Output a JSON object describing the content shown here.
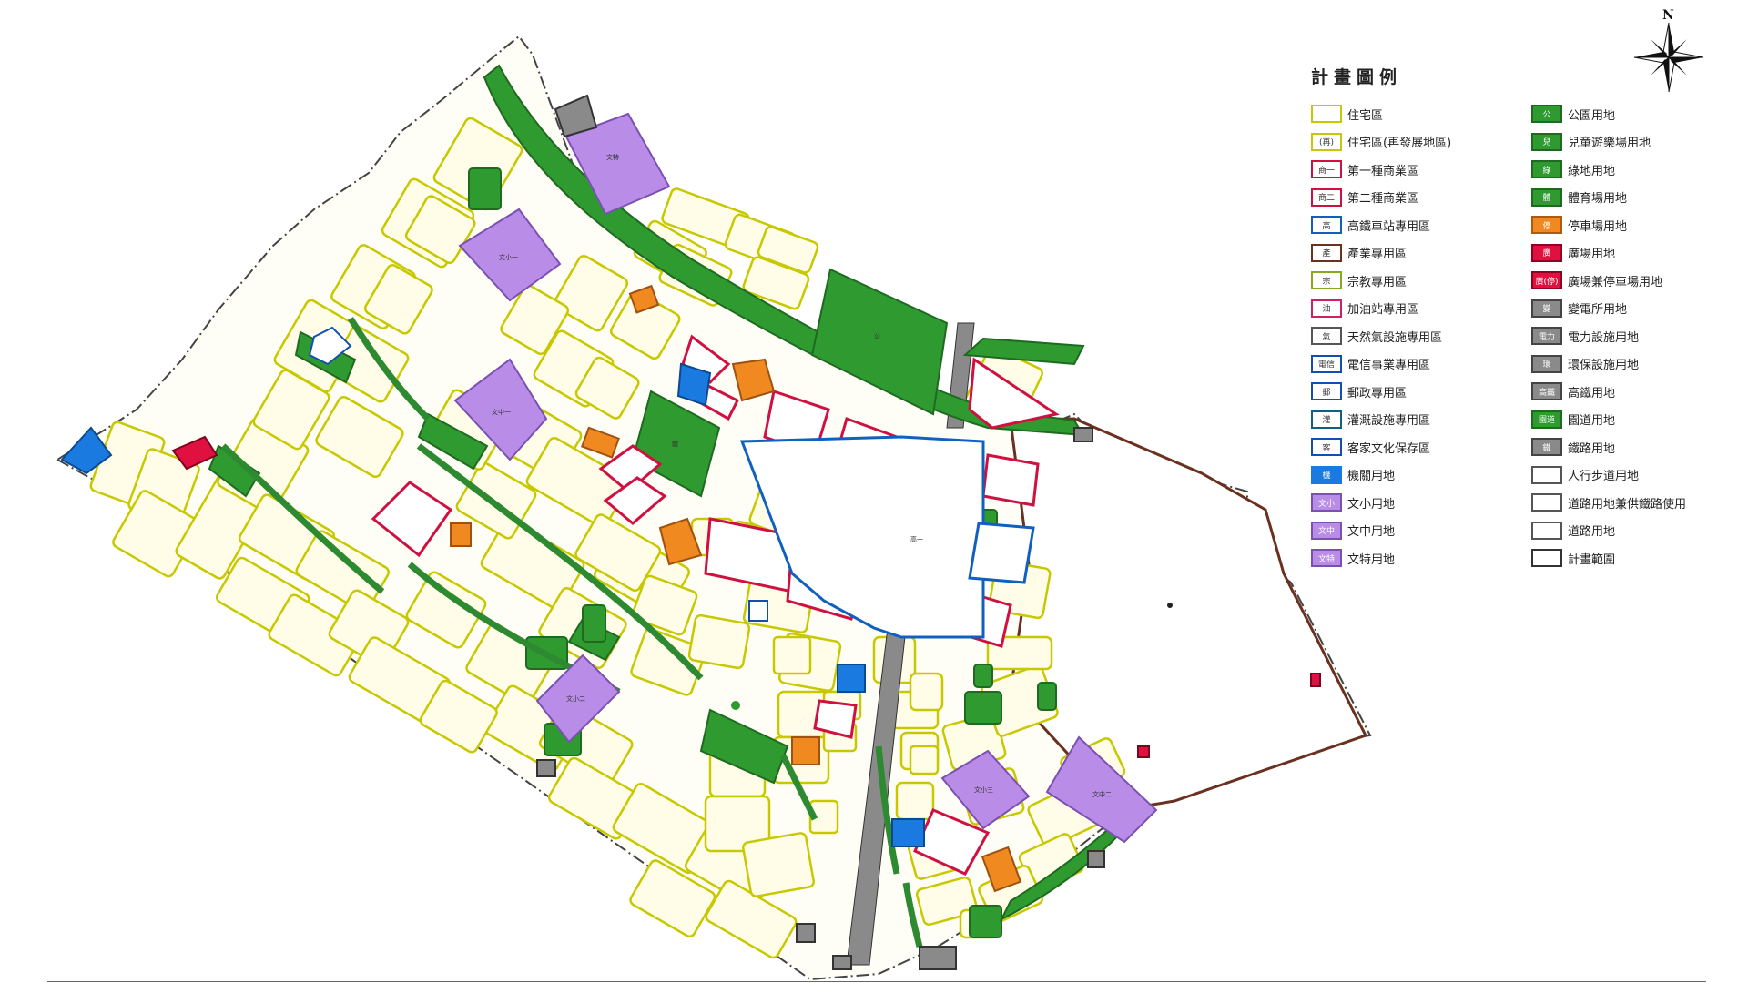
{
  "compass": {
    "north_label": "N"
  },
  "legend": {
    "title": "計畫圖例",
    "left_items": [
      {
        "label": "住宅區",
        "code": "",
        "fill": "#ffffff",
        "border": "#c8c800"
      },
      {
        "label": "住宅區(再發展地區)",
        "code": "(再)",
        "fill": "#ffffff",
        "border": "#c8c800"
      },
      {
        "label": "第一種商業區",
        "code": "商一",
        "fill": "#ffffff",
        "border": "#d01040"
      },
      {
        "label": "第二種商業區",
        "code": "商二",
        "fill": "#ffffff",
        "border": "#d01040"
      },
      {
        "label": "高鐵車站專用區",
        "code": "高",
        "fill": "#ffffff",
        "border": "#1060c0"
      },
      {
        "label": "產業專用區",
        "code": "產",
        "fill": "#ffffff",
        "border": "#6a3020"
      },
      {
        "label": "宗教專用區",
        "code": "宗",
        "fill": "#ffffff",
        "border": "#88aa20"
      },
      {
        "label": "加油站專用區",
        "code": "油",
        "fill": "#ffffff",
        "border": "#d02060"
      },
      {
        "label": "天然氣設施專用區",
        "code": "氣",
        "fill": "#ffffff",
        "border": "#555555"
      },
      {
        "label": "電信事業專用區",
        "code": "電信",
        "fill": "#ffffff",
        "border": "#1050b0"
      },
      {
        "label": "郵政專用區",
        "code": "郵",
        "fill": "#ffffff",
        "border": "#1050b0"
      },
      {
        "label": "灌溉設施專用區",
        "code": "灌",
        "fill": "#ffffff",
        "border": "#106080"
      },
      {
        "label": "客家文化保存區",
        "code": "客",
        "fill": "#ffffff",
        "border": "#1050b0"
      },
      {
        "label": "機關用地",
        "code": "機",
        "fill": "#1a7ae0",
        "border": "#1a7ae0"
      },
      {
        "label": "文小用地",
        "code": "文小",
        "fill": "#b98ce8",
        "border": "#7a50b0"
      },
      {
        "label": "文中用地",
        "code": "文中",
        "fill": "#b98ce8",
        "border": "#7a50b0"
      },
      {
        "label": "文特用地",
        "code": "文特",
        "fill": "#b98ce8",
        "border": "#7a50b0"
      }
    ],
    "right_items": [
      {
        "label": "公園用地",
        "code": "公",
        "fill": "#2e9a30",
        "border": "#1e6a20"
      },
      {
        "label": "兒童遊樂場用地",
        "code": "兒",
        "fill": "#2e9a30",
        "border": "#1e6a20"
      },
      {
        "label": "綠地用地",
        "code": "綠",
        "fill": "#2e9a30",
        "border": "#1e6a20"
      },
      {
        "label": "體育場用地",
        "code": "體",
        "fill": "#2e9a30",
        "border": "#1e6a20"
      },
      {
        "label": "停車場用地",
        "code": "停",
        "fill": "#f08a20",
        "border": "#b05a10"
      },
      {
        "label": "廣場用地",
        "code": "廣",
        "fill": "#e01040",
        "border": "#900020"
      },
      {
        "label": "廣場兼停車場用地",
        "code": "廣(停)",
        "fill": "#e01040",
        "border": "#900020"
      },
      {
        "label": "變電所用地",
        "code": "變",
        "fill": "#8a8a8a",
        "border": "#444444"
      },
      {
        "label": "電力設施用地",
        "code": "電力",
        "fill": "#8a8a8a",
        "border": "#444444"
      },
      {
        "label": "環保設施用地",
        "code": "環",
        "fill": "#8a8a8a",
        "border": "#444444"
      },
      {
        "label": "高鐵用地",
        "code": "高鐵",
        "fill": "#8a8a8a",
        "border": "#444444"
      },
      {
        "label": "園道用地",
        "code": "園道",
        "fill": "#2e9a30",
        "border": "#1e6a20"
      },
      {
        "label": "鐵路用地",
        "code": "鐵",
        "fill": "#8a8a8a",
        "border": "#444444"
      },
      {
        "label": "人行步道用地",
        "code": "",
        "fill": "#ffffff",
        "border": "#555555"
      },
      {
        "label": "道路用地兼供鐵路使用",
        "code": "",
        "fill": "#ffffff",
        "border": "#555555"
      },
      {
        "label": "道路用地",
        "code": "",
        "fill": "#ffffff",
        "border": "#555555"
      },
      {
        "label": "計畫範圍",
        "code": "",
        "fill": "#ffffff",
        "border": "#333333"
      }
    ]
  },
  "colors": {
    "residential_fill": "#fffde8",
    "residential_border": "#c8c800",
    "commercial_border": "#d01040",
    "station_border": "#1060c0",
    "green": "#2e9a30",
    "school": "#b98ce8",
    "parking": "#f08a20",
    "government": "#1a7ae0",
    "plaza": "#e01040",
    "utility": "#8a8a8a",
    "boundary": "#6a3020"
  },
  "map_labels": {
    "station_zone": "高一",
    "culture_school": "文特",
    "school_1": "文小一",
    "school_2": "文中一",
    "school_3": "文小二",
    "school_4": "文小三",
    "school_5": "文中二",
    "park_big": "公",
    "sports": "體"
  }
}
